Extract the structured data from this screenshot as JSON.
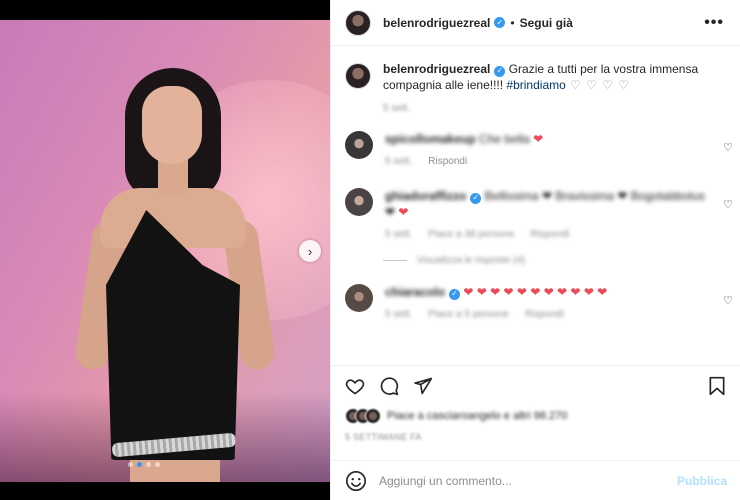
{
  "header": {
    "username": "belenrodriguezreal",
    "separator": "•",
    "follow_label": "Segui già",
    "more_glyph": "•••"
  },
  "caption": {
    "username": "belenrodriguezreal",
    "text": "Grazie a tutti per la vostra immensa compagnia alle iene!!!! ",
    "hashtag": "#brindiamo",
    "trailing": " ♡ ♡ ♡ ♡",
    "time": "5 sett."
  },
  "comments": [
    {
      "username": "spicollomakeup",
      "text": "Che bella ",
      "heart": "❤",
      "meta": [
        "5 sett.",
        "Rispondi"
      ],
      "meta_blurred": [
        true,
        false
      ],
      "avatar_color": "#3a3536"
    },
    {
      "username": "ghiadoraffizzo",
      "text": "Bellissima ❤ Bravissima ❤ Bogotabbotus ❤",
      "heart": "❤",
      "meta": [
        "5 sett.",
        "Piace a 38 persone",
        "Rispondi"
      ],
      "meta_blurred": [
        true,
        true,
        true
      ],
      "replies_label": "Visualizza le risposte (4)",
      "avatar_color": "#4a4446"
    },
    {
      "username": "chiaracolo",
      "text": "",
      "heart": "❤ ❤ ❤ ❤ ❤ ❤ ❤ ❤ ❤ ❤ ❤",
      "meta": [
        "5 sett.",
        "Piace a 5 persone",
        "Rispondi"
      ],
      "meta_blurred": [
        true,
        true,
        true
      ],
      "avatar_color": "#574a44"
    }
  ],
  "actions": {
    "like_icon": "heart-outline-icon",
    "comment_icon": "comment-icon",
    "share_icon": "send-icon",
    "save_icon": "bookmark-icon"
  },
  "likes": {
    "text": "Piace a casciaroangelo e altri 98.270"
  },
  "date": "5 SETTIMANE FA",
  "add_comment": {
    "placeholder": "Aggiungi un commento...",
    "publish_label": "Pubblica"
  },
  "colors": {
    "verified": "#3897f0",
    "hashtag": "#00376b",
    "heart_red": "#ed4956",
    "publish_disabled": "#b2dffc",
    "carousel_active_dot": "#3b93f0"
  },
  "carousel": {
    "next_glyph": "›",
    "slides": 4,
    "active": 1
  }
}
